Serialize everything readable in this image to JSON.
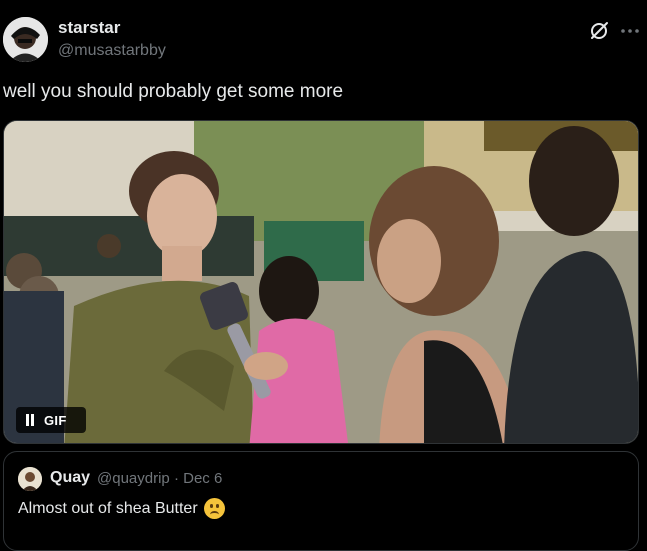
{
  "post": {
    "author_name": "starstar",
    "author_handle": "@musastarbby",
    "text": "well you should probably get some more",
    "icons": [
      "grok-icon",
      "more-icon",
      "pause-icon",
      "emoji-icon"
    ]
  },
  "media": {
    "type_label": "GIF",
    "description_visible": false
  },
  "quote": {
    "author_name": "Quay",
    "author_handle": "@quaydrip",
    "separator": "·",
    "date": "Dec 6",
    "text": "Almost out of shea Butter",
    "emoji": "slightly-frowning-face"
  },
  "colors": {
    "background": "#000000",
    "text_primary": "#e7e9ea",
    "text_secondary": "#71767b",
    "border": "#2f3336"
  }
}
